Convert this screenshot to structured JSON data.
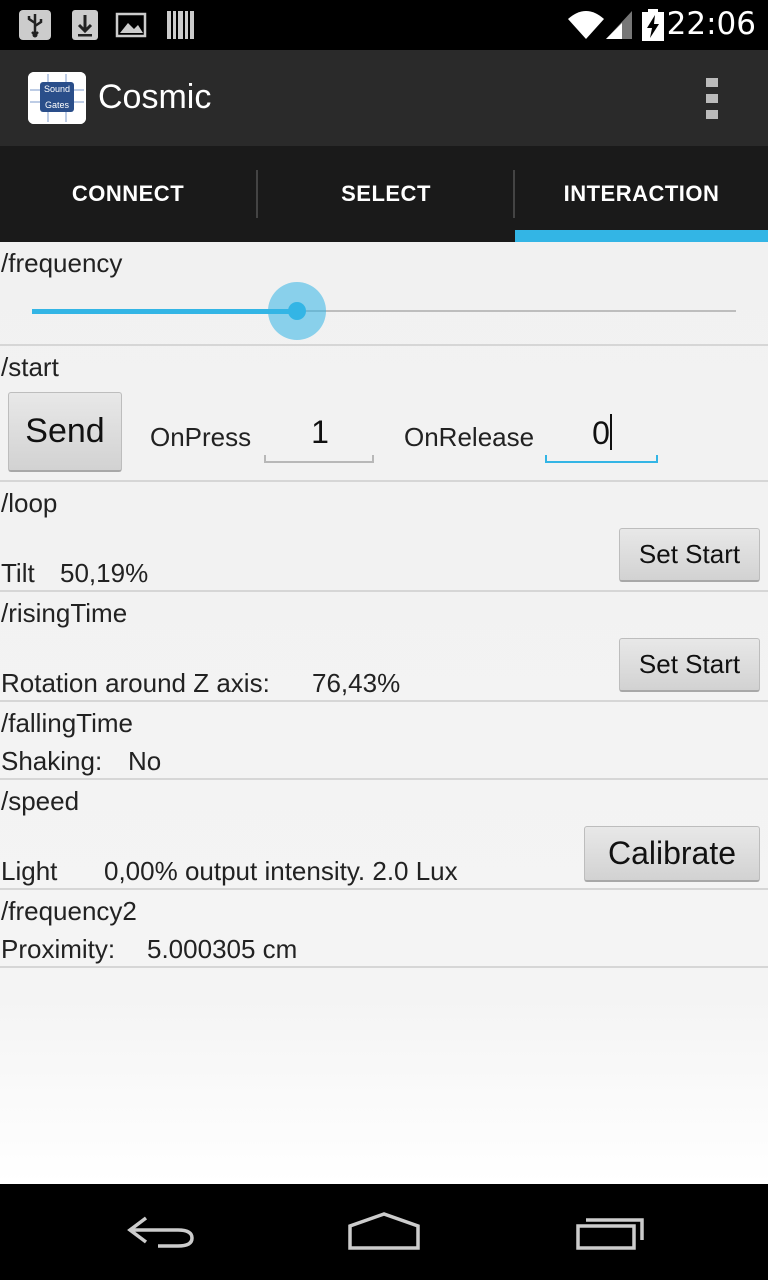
{
  "status_bar": {
    "time": "22:06",
    "icons": [
      "usb-icon",
      "download-icon",
      "image-icon",
      "barcode-icon",
      "wifi-icon",
      "signal-icon",
      "battery-charging-icon"
    ]
  },
  "action_bar": {
    "app_icon_text_line1": "Sound",
    "app_icon_text_line2": "Gates",
    "title": "Cosmic",
    "overflow_icon": "overflow-menu-icon"
  },
  "tabs": [
    {
      "label": "CONNECT",
      "selected": false
    },
    {
      "label": "SELECT",
      "selected": false
    },
    {
      "label": "INTERACTION",
      "selected": true
    }
  ],
  "accent_color": "#33b5e5",
  "content": {
    "frequency": {
      "label": "/frequency",
      "slider_fraction": 0.377
    },
    "start": {
      "label": "/start",
      "send_button": "Send",
      "on_press_label": "OnPress",
      "on_press_value": "1",
      "on_release_label": "OnRelease",
      "on_release_value": "0"
    },
    "loop": {
      "label": "/loop",
      "sensor_label": "Tilt",
      "sensor_value": "50,19%",
      "button": "Set Start"
    },
    "rising_time": {
      "label": "/risingTime",
      "sensor_label": "Rotation around Z axis:",
      "sensor_value": "76,43%",
      "button": "Set Start"
    },
    "falling_time": {
      "label": "/fallingTime",
      "sensor_label": "Shaking:",
      "sensor_value": "No"
    },
    "speed": {
      "label": "/speed",
      "sensor_label": "Light",
      "sensor_value": "0,00% output intensity. 2.0 Lux",
      "button": "Calibrate"
    },
    "frequency2": {
      "label": "/frequency2",
      "sensor_label": "Proximity:",
      "sensor_value": "5.000305 cm"
    }
  },
  "nav_bar": {
    "icons": [
      "back-icon",
      "home-icon",
      "recent-apps-icon"
    ]
  }
}
